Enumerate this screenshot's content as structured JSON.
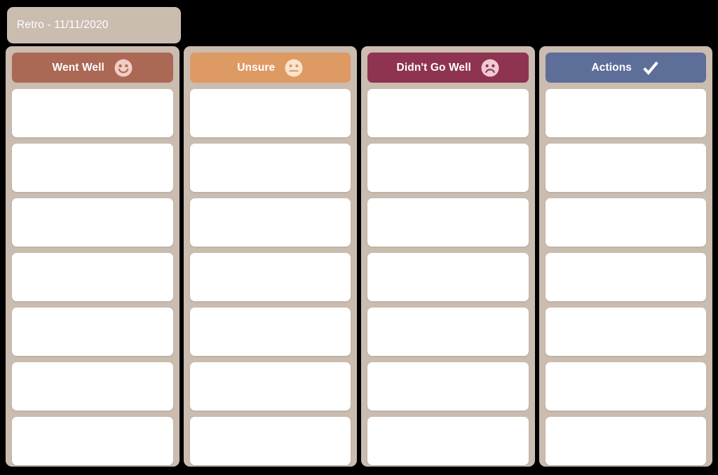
{
  "board": {
    "title": "Retro - 11/11/2020",
    "background_color": "#000000",
    "panel_color": "#cbbcb0",
    "card_color": "#ffffff",
    "columns": [
      {
        "label": "Went Well",
        "icon": "smiley-face-icon",
        "accent_color": "#ab6854",
        "icon_color": "#f0cec4",
        "cards": [
          "",
          "",
          "",
          "",
          "",
          "",
          ""
        ]
      },
      {
        "label": "Unsure",
        "icon": "neutral-face-icon",
        "accent_color": "#dd9a63",
        "icon_color": "#fae3cf",
        "cards": [
          "",
          "",
          "",
          "",
          "",
          "",
          ""
        ]
      },
      {
        "label": "Didn't Go Well",
        "icon": "sad-face-icon",
        "accent_color": "#8e3450",
        "icon_color": "#efcbd2",
        "cards": [
          "",
          "",
          "",
          "",
          "",
          "",
          ""
        ]
      },
      {
        "label": "Actions",
        "icon": "checkmark-icon",
        "accent_color": "#5d6e99",
        "icon_color": "#ffffff",
        "cards": [
          "",
          "",
          "",
          "",
          "",
          "",
          ""
        ]
      }
    ]
  }
}
